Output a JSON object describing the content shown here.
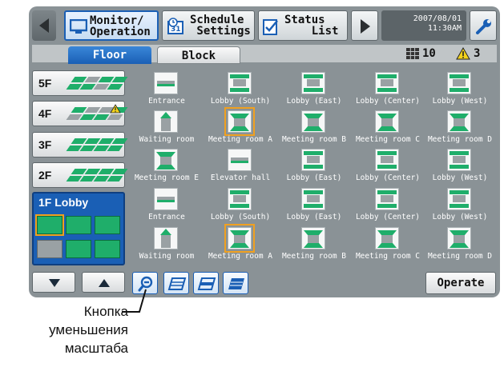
{
  "topbar": {
    "monitor_label": "Monitor/\nOperation",
    "schedule_label": "Schedule\n Settings",
    "status_label": "Status\n    List",
    "date": "2007/08/01",
    "time": "11:30AM"
  },
  "tabs": {
    "floor": "Floor",
    "block": "Block"
  },
  "status": {
    "units_count": "10",
    "alert_count": "3"
  },
  "floors": [
    {
      "label": "5F"
    },
    {
      "label": "4F"
    },
    {
      "label": "3F"
    },
    {
      "label": "2F"
    }
  ],
  "current_floor": "1F Lobby",
  "units": [
    {
      "name": "Entrance",
      "type": "wall"
    },
    {
      "name": "Lobby (South)",
      "type": "ceiling"
    },
    {
      "name": "Lobby (East)",
      "type": "ceiling"
    },
    {
      "name": "Lobby (Center)",
      "type": "ceiling"
    },
    {
      "name": "Lobby (West)",
      "type": "ceiling"
    },
    {
      "name": "Waiting room",
      "type": "floor"
    },
    {
      "name": "Meeting room A",
      "type": "cassette",
      "selected": true
    },
    {
      "name": "Meeting room B",
      "type": "cassette"
    },
    {
      "name": "Meeting room C",
      "type": "cassette"
    },
    {
      "name": "Meeting room D",
      "type": "cassette"
    },
    {
      "name": "Meeting room E",
      "type": "cassette"
    },
    {
      "name": "Elevator hall",
      "type": "wall"
    },
    {
      "name": "Lobby (East)",
      "type": "ceiling"
    },
    {
      "name": "Lobby (Center)",
      "type": "ceiling"
    },
    {
      "name": "Lobby (West)",
      "type": "ceiling"
    },
    {
      "name": "Entrance",
      "type": "wall"
    },
    {
      "name": "Lobby (South)",
      "type": "ceiling"
    },
    {
      "name": "Lobby (East)",
      "type": "ceiling"
    },
    {
      "name": "Lobby (Center)",
      "type": "ceiling"
    },
    {
      "name": "Lobby (West)",
      "type": "ceiling"
    },
    {
      "name": "Waiting room",
      "type": "floor"
    },
    {
      "name": "Meeting room A",
      "type": "cassette",
      "selected": true
    },
    {
      "name": "Meeting room B",
      "type": "cassette"
    },
    {
      "name": "Meeting room C",
      "type": "cassette"
    },
    {
      "name": "Meeting room D",
      "type": "cassette"
    }
  ],
  "bottom": {
    "operate_label": "Operate"
  },
  "caption": {
    "line1": "Кнопка",
    "line2": "уменьшения",
    "line3": "масштаба"
  },
  "colors": {
    "accent": "#1a5fb5",
    "unit_green": "#1fae6a",
    "selection": "#f0a020",
    "panel": "#8a9296"
  }
}
